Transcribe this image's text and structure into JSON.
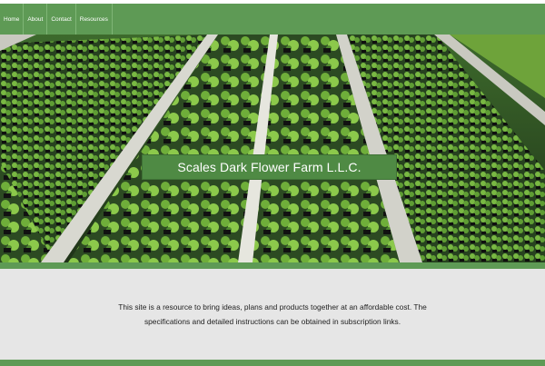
{
  "nav": {
    "items": [
      {
        "label": "Home"
      },
      {
        "label": "About"
      },
      {
        "label": "Contact"
      },
      {
        "label": "Resources"
      }
    ]
  },
  "hero": {
    "title": "Scales Dark Flower Farm L.L.C."
  },
  "content": {
    "line1": "This site is a resource to bring ideas, plans and products together at an affordable cost. The",
    "line2": "specifications and detailed instructions can be obtained in subscription links."
  },
  "colors": {
    "brand_green": "#5e9a55",
    "banner_green": "#4f8a44",
    "content_bg": "#e6e6e6"
  }
}
